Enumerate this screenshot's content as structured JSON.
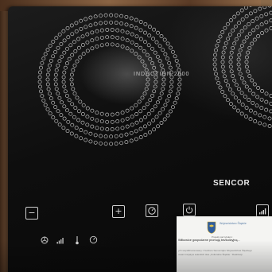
{
  "cooktop": {
    "model_label": "INDUCTION 2000",
    "brand": "SENCOR"
  },
  "controls": {
    "minus_symbol": "−",
    "plus_symbol": "+"
  },
  "paper": {
    "crest_caption": "Województwo Śląskie",
    "subheading": "Projekt pod tytułem:",
    "heading": "Wiłkowice gospodarne promują bezkolizyjną...",
    "lines": [
      "ych współfinansowany z budżetu Samorządu Województwa Śląskiego",
      "owani inicjatyw sołeckich skie „Kulturalne Śląskie \" Realizacji"
    ]
  },
  "colors": {
    "glass": "#0e0e0e",
    "ring_dots": "#d9d9d9",
    "wood": "#7d5a3d",
    "paper": "#f4f4f2"
  }
}
